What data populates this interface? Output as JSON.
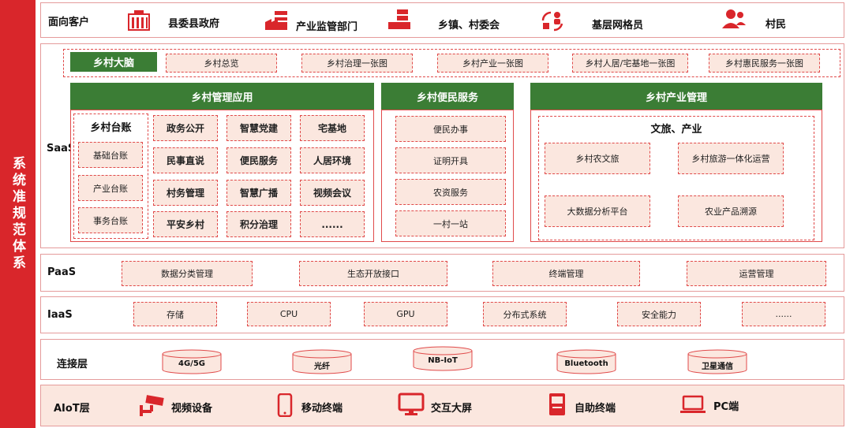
{
  "sidebar": {
    "title": "系统准规范体系"
  },
  "customers": {
    "label": "面向客户",
    "items": [
      {
        "label": "县委县政府",
        "icon": "government-building-icon"
      },
      {
        "label": "产业监管部门",
        "icon": "industry-factory-icon"
      },
      {
        "label": "乡镇、村委会",
        "icon": "township-building-icon"
      },
      {
        "label": "基层网格员",
        "icon": "grid-workers-icon"
      },
      {
        "label": "村民",
        "icon": "villagers-icon"
      }
    ]
  },
  "saas": {
    "label": "SaaS",
    "brain": {
      "title": "乡村大脑",
      "items": [
        "乡村总览",
        "乡村治理一张图",
        "乡村产业一张图",
        "乡村人居/宅基地一张图",
        "乡村惠民服务一张图"
      ]
    },
    "management": {
      "title": "乡村管理应用",
      "ledger": {
        "title": "乡村台账",
        "items": [
          "基础台账",
          "产业台账",
          "事务台账"
        ]
      },
      "grid": [
        "政务公开",
        "智慧党建",
        "宅基地",
        "民事直说",
        "便民服务",
        "人居环境",
        "村务管理",
        "智慧广播",
        "视频会议",
        "平安乡村",
        "积分治理",
        "......"
      ]
    },
    "services": {
      "title": "乡村便民服务",
      "items": [
        "便民办事",
        "证明开具",
        "农资服务",
        "一村一站"
      ]
    },
    "industry": {
      "title": "乡村产业管理",
      "subtitle": "文旅、产业",
      "items": [
        "乡村农文旅",
        "乡村旅游一体化运营",
        "大数据分析平台",
        "农业产品溯源"
      ]
    }
  },
  "paas": {
    "label": "PaaS",
    "items": [
      "数据分类管理",
      "生态开放接口",
      "终端管理",
      "运营管理"
    ]
  },
  "iaas": {
    "label": "IaaS",
    "items": [
      "存储",
      "CPU",
      "GPU",
      "分布式系统",
      "安全能力",
      "......"
    ]
  },
  "connect": {
    "label": "连接层",
    "items": [
      "4G/5G",
      "光纤",
      "NB-IoT",
      "Bluetooth",
      "卫星通信"
    ]
  },
  "aiot": {
    "label": "AIoT层",
    "items": [
      {
        "label": "视频设备",
        "icon": "cctv-camera-icon"
      },
      {
        "label": "移动终端",
        "icon": "mobile-phone-icon"
      },
      {
        "label": "交互大屏",
        "icon": "monitor-screen-icon"
      },
      {
        "label": "自助终端",
        "icon": "kiosk-terminal-icon"
      },
      {
        "label": "PC端",
        "icon": "laptop-icon"
      }
    ]
  },
  "colors": {
    "red": "#d9262b",
    "green": "#3b7d35",
    "pink_fill": "#fbe7df"
  }
}
